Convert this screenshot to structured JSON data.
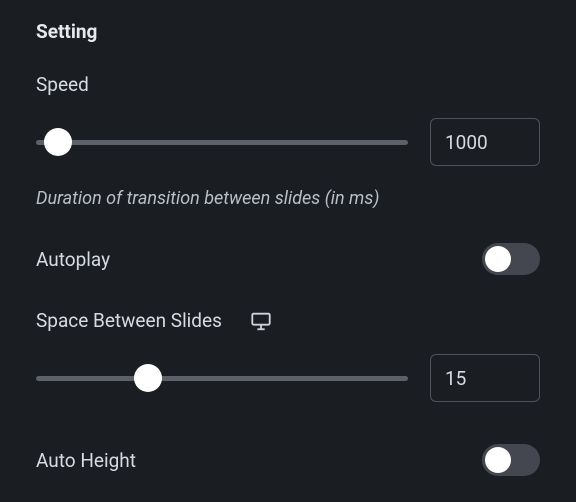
{
  "section_title": "Setting",
  "speed": {
    "label": "Speed",
    "value": "1000",
    "thumb_pct": 6,
    "help": "Duration of transition between slides (in ms)"
  },
  "autoplay": {
    "label": "Autoplay",
    "on": false
  },
  "space": {
    "label": "Space Between Slides",
    "value": "15",
    "thumb_pct": 30
  },
  "auto_height": {
    "label": "Auto Height",
    "on": false
  }
}
